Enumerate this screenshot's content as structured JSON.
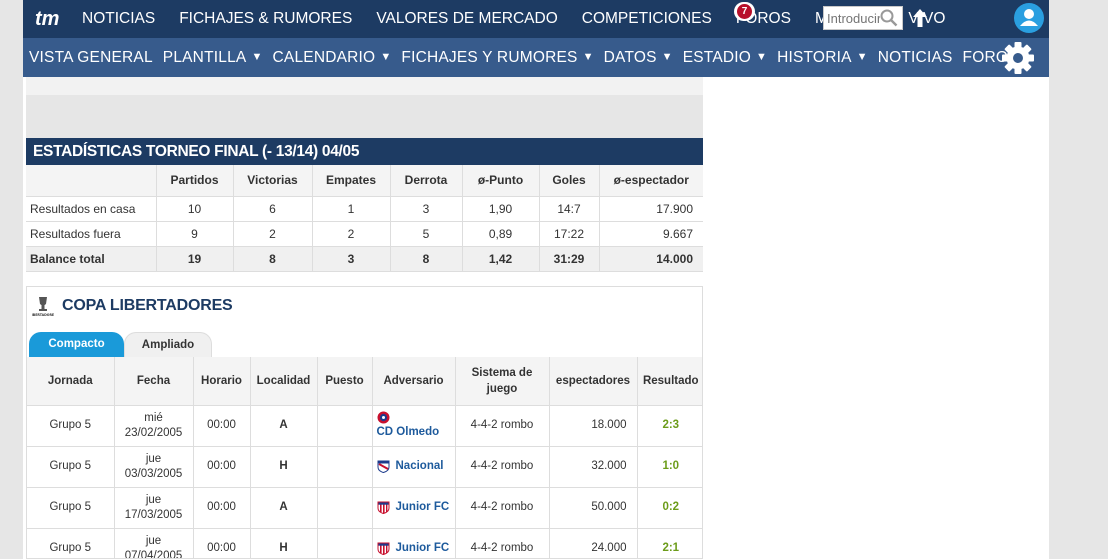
{
  "topbar": {
    "logo_text": "tm",
    "nav": [
      "NOTICIAS",
      "FICHAJES & RUMORES",
      "VALORES DE MERCADO",
      "COMPETICIONES",
      "FOROS",
      "MI TM",
      "EN VIVO"
    ],
    "live_count": "7",
    "search_placeholder": "Introducir"
  },
  "subnav": {
    "items": [
      {
        "label": "VISTA GENERAL",
        "dropdown": false
      },
      {
        "label": "PLANTILLA",
        "dropdown": true
      },
      {
        "label": "CALENDARIO",
        "dropdown": true
      },
      {
        "label": "FICHAJES Y RUMORES",
        "dropdown": true
      },
      {
        "label": "DATOS",
        "dropdown": true
      },
      {
        "label": "ESTADIO",
        "dropdown": true
      },
      {
        "label": "HISTORIA",
        "dropdown": true
      },
      {
        "label": "NOTICIAS",
        "dropdown": false
      },
      {
        "label": "FORO",
        "dropdown": false
      }
    ],
    "caret": "▼"
  },
  "stats": {
    "title": "ESTADÍSTICAS TORNEO FINAL (- 13/14) 04/05",
    "headers": [
      "",
      "Partidos",
      "Victorias",
      "Empates",
      "Derrota",
      "ø-Punto",
      "Goles",
      "ø-espectador"
    ],
    "rows": [
      [
        "Resultados en casa",
        "10",
        "6",
        "1",
        "3",
        "1,90",
        "14:7",
        "17.900"
      ],
      [
        "Resultados fuera",
        "9",
        "2",
        "2",
        "5",
        "0,89",
        "17:22",
        "9.667"
      ]
    ],
    "total": [
      "Balance total",
      "19",
      "8",
      "3",
      "8",
      "1,42",
      "31:29",
      "14.000"
    ]
  },
  "copa": {
    "title": "COPA LIBERTADORES",
    "logo_text": "CONMEBOL LIBERTADORES",
    "tabs": [
      "Compacto",
      "Ampliado"
    ],
    "headers": [
      "Jornada",
      "Fecha",
      "Horario",
      "Localidad",
      "Puesto",
      "Adversario",
      "Sistema de juego",
      "espectadores",
      "Resultado"
    ],
    "rows": [
      {
        "jornada": "Grupo 5",
        "dia": "mié",
        "fecha": "23/02/2005",
        "horario": "00:00",
        "localidad": "A",
        "puesto": "",
        "adversario": "CD Olmedo",
        "sistema": "4-4-2 rombo",
        "espectadores": "18.000",
        "resultado": "2:3",
        "crest": "olmedo"
      },
      {
        "jornada": "Grupo 5",
        "dia": "jue",
        "fecha": "03/03/2005",
        "horario": "00:00",
        "localidad": "H",
        "puesto": "",
        "adversario": "Nacional",
        "sistema": "4-4-2 rombo",
        "espectadores": "32.000",
        "resultado": "1:0",
        "crest": "nacional"
      },
      {
        "jornada": "Grupo 5",
        "dia": "jue",
        "fecha": "17/03/2005",
        "horario": "00:00",
        "localidad": "A",
        "puesto": "",
        "adversario": "Junior FC",
        "sistema": "4-4-2 rombo",
        "espectadores": "50.000",
        "resultado": "0:2",
        "crest": "junior"
      },
      {
        "jornada": "Grupo 5",
        "dia": "jue",
        "fecha": "07/04/2005",
        "horario": "00:00",
        "localidad": "H",
        "puesto": "",
        "adversario": "Junior FC",
        "sistema": "4-4-2 rombo",
        "espectadores": "24.000",
        "resultado": "2:1",
        "crest": "junior"
      }
    ]
  },
  "colors": {
    "topbar": "#1d3b63",
    "subnav": "#375b8c",
    "tab_active": "#1a9ad9",
    "result_link": "#6c9c1a",
    "team_link": "#1d5a9c"
  }
}
